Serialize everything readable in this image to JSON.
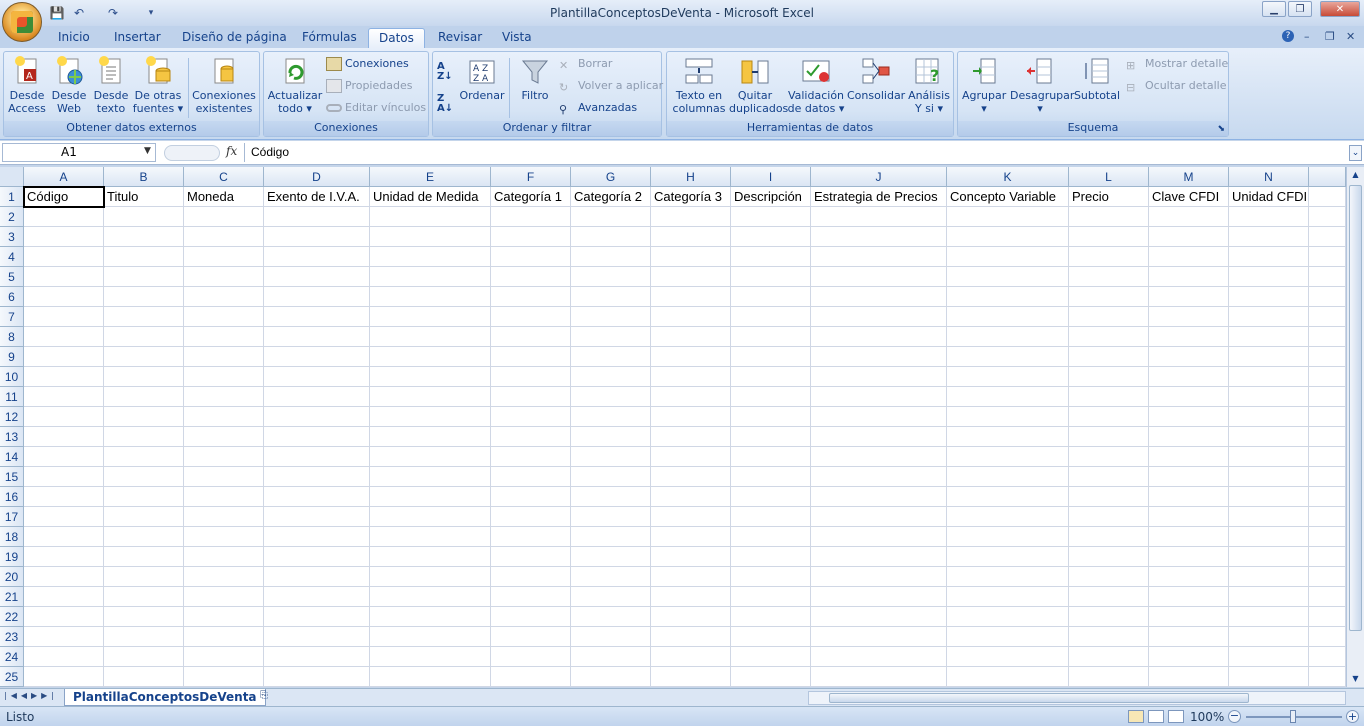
{
  "window": {
    "title": "PlantillaConceptosDeVenta - Microsoft Excel"
  },
  "tabs": [
    "Inicio",
    "Insertar",
    "Diseño de página",
    "Fórmulas",
    "Datos",
    "Revisar",
    "Vista"
  ],
  "active_tab": "Datos",
  "ribbon": {
    "groups": {
      "external": "Obtener datos externos",
      "connections": "Conexiones",
      "sortfilter": "Ordenar y filtrar",
      "tools": "Herramientas de datos",
      "outline": "Esquema"
    },
    "from_access": [
      "Desde",
      "Access"
    ],
    "from_web": [
      "Desde",
      "Web"
    ],
    "from_text": [
      "Desde",
      "texto"
    ],
    "from_other": [
      "De otras",
      "fuentes ▾"
    ],
    "existing": [
      "Conexiones",
      "existentes"
    ],
    "refresh": [
      "Actualizar",
      "todo ▾"
    ],
    "connections_btn": "Conexiones",
    "properties": "Propiedades",
    "edit_links": "Editar vínculos",
    "sort_az_icon": "sort-ascending-icon",
    "sort": "Ordenar",
    "filter": "Filtro",
    "clear": "Borrar",
    "reapply": "Volver a aplicar",
    "advanced": "Avanzadas",
    "text_to_columns": [
      "Texto en",
      "columnas"
    ],
    "remove_dups": [
      "Quitar",
      "duplicados"
    ],
    "validation": [
      "Validación",
      "de datos ▾"
    ],
    "consolidate": "Consolidar",
    "whatif": [
      "Análisis",
      "Y si ▾"
    ],
    "group": "Agrupar",
    "ungroup": "Desagrupar",
    "subtotal": "Subtotal",
    "show_detail": "Mostrar detalle",
    "hide_detail": "Ocultar detalle"
  },
  "formula_bar": {
    "name_box": "A1",
    "fx": "fx",
    "value": "Código"
  },
  "columns": [
    "A",
    "B",
    "C",
    "D",
    "E",
    "F",
    "G",
    "H",
    "I",
    "J",
    "K",
    "L",
    "M",
    "N"
  ],
  "rows": [
    "1",
    "2",
    "3",
    "4",
    "5",
    "6",
    "7",
    "8",
    "9",
    "10",
    "11",
    "12",
    "13",
    "14",
    "15",
    "16",
    "17",
    "18",
    "19",
    "20",
    "21",
    "22",
    "23",
    "24",
    "25"
  ],
  "row1": [
    "Código",
    "Titulo",
    "Moneda",
    "Exento de I.V.A.",
    "Unidad de Medida",
    "Categoría 1",
    "Categoría 2",
    "Categoría 3",
    "Descripción",
    "Estrategia de Precios",
    "Concepto Variable",
    "Precio",
    "Clave CFDI",
    "Unidad CFDI"
  ],
  "sheet_tab": "PlantillaConceptosDeVenta",
  "status": {
    "ready": "Listo",
    "zoom": "100%"
  },
  "colors": {
    "accent": "#15428b",
    "ribbon_bg": "#dbe7f6"
  }
}
